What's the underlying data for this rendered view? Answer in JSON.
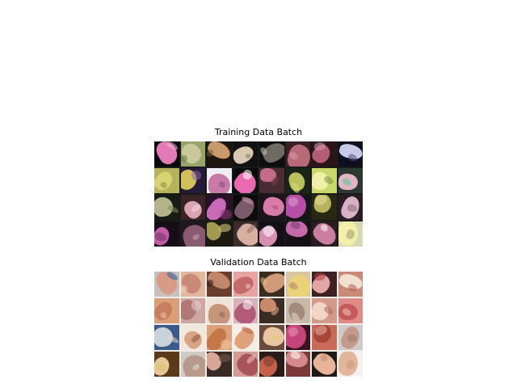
{
  "train": {
    "title": "Training Data Batch",
    "tiles": [
      {
        "bg": "#0a0a0a",
        "fg": "#e27bb5",
        "alt": "#f4b7d6"
      },
      {
        "bg": "#9aa36a",
        "fg": "#c9c89a",
        "alt": "#6f7a46"
      },
      {
        "bg": "#1b1410",
        "fg": "#c89a6a",
        "alt": "#7a5a3c"
      },
      {
        "bg": "#121212",
        "fg": "#d9c9b0",
        "alt": "#8b7a64"
      },
      {
        "bg": "#0d0d0d",
        "fg": "#6f6a62",
        "alt": "#c7c0b4"
      },
      {
        "bg": "#3a1f23",
        "fg": "#b86a79",
        "alt": "#dc9aa9"
      },
      {
        "bg": "#2a1518",
        "fg": "#b35d74",
        "alt": "#d79aae"
      },
      {
        "bg": "#0e1020",
        "fg": "#c7c9e6",
        "alt": "#4c4f7a"
      },
      {
        "bg": "#b6b15c",
        "fg": "#d7d474",
        "alt": "#8c8a3e"
      },
      {
        "bg": "#251a38",
        "fg": "#d1c05a",
        "alt": "#8a6aa8"
      },
      {
        "bg": "#f1edf4",
        "fg": "#c77aa8",
        "alt": "#8a4f7a"
      },
      {
        "bg": "#0b0b0b",
        "fg": "#e86ab0",
        "alt": "#ffffff"
      },
      {
        "bg": "#4a2c34",
        "fg": "#c26c88",
        "alt": "#7b3a51"
      },
      {
        "bg": "#1a2419",
        "fg": "#b9c05c",
        "alt": "#d7d879"
      },
      {
        "bg": "#c8d96a",
        "fg": "#efefaa",
        "alt": "#7d8e3b"
      },
      {
        "bg": "#2d3830",
        "fg": "#e1b5c3",
        "alt": "#56c79d"
      },
      {
        "bg": "#171d15",
        "fg": "#b4b48a",
        "alt": "#7f8a56"
      },
      {
        "bg": "#3a2226",
        "fg": "#d9a4b2",
        "alt": "#f1d7df"
      },
      {
        "bg": "#2b1029",
        "fg": "#c86bb6",
        "alt": "#8a3b7a"
      },
      {
        "bg": "#0b0b0b",
        "fg": "#7a5a6a",
        "alt": "#c39aac"
      },
      {
        "bg": "#1c1419",
        "fg": "#d97aa8",
        "alt": "#a24f7a"
      },
      {
        "bg": "#151515",
        "fg": "#b64fa6",
        "alt": "#dca3cd"
      },
      {
        "bg": "#2a2815",
        "fg": "#b7b25d",
        "alt": "#e6e39a"
      },
      {
        "bg": "#2a1e24",
        "fg": "#d7b2c3",
        "alt": "#8a6a80"
      },
      {
        "bg": "#160d18",
        "fg": "#c45ba6",
        "alt": "#6a3a66"
      },
      {
        "bg": "#21181d",
        "fg": "#8a5a73",
        "alt": "#cda1b7"
      },
      {
        "bg": "#1c190e",
        "fg": "#a39a52",
        "alt": "#e0d68a"
      },
      {
        "bg": "#3b2e2a",
        "fg": "#d7b0a2",
        "alt": "#9b6f62"
      },
      {
        "bg": "#151015",
        "fg": "#d48fb3",
        "alt": "#ffffff"
      },
      {
        "bg": "#161016",
        "fg": "#c46aa8",
        "alt": "#7a3a6a"
      },
      {
        "bg": "#2a1d22",
        "fg": "#c87fa0",
        "alt": "#ffffff"
      },
      {
        "bg": "#d8d8b0",
        "fg": "#f1efa8",
        "alt": "#9b9a6a"
      }
    ]
  },
  "val": {
    "title": "Validation Data Batch",
    "tiles": [
      {
        "bg": "#c7c0bd",
        "fg": "#d89b86",
        "alt": "#2c5c9a"
      },
      {
        "bg": "#e2b7a2",
        "fg": "#c88a74",
        "alt": "#f1d2c2"
      },
      {
        "bg": "#6a3e2c",
        "fg": "#c1876a",
        "alt": "#2a1a14"
      },
      {
        "bg": "#e7a2a2",
        "fg": "#c56a6a",
        "alt": "#f7d0c8"
      },
      {
        "bg": "#3a2c1e",
        "fg": "#d09a7a",
        "alt": "#e8c07a"
      },
      {
        "bg": "#d6c7a2",
        "fg": "#e9d27a",
        "alt": "#b87a6a"
      },
      {
        "bg": "#3e2222",
        "fg": "#e3a6a6",
        "alt": "#b23a3a"
      },
      {
        "bg": "#c98a78",
        "fg": "#f1e0d0",
        "alt": "#b55a5a"
      },
      {
        "bg": "#d89f7a",
        "fg": "#c97e60",
        "alt": "#e9c2a4"
      },
      {
        "bg": "#cda7a2",
        "fg": "#b07878",
        "alt": "#e9d0cb"
      },
      {
        "bg": "#efe2d6",
        "fg": "#c7967a",
        "alt": "#8a6a5a"
      },
      {
        "bg": "#d7b1bb",
        "fg": "#b25a7a",
        "alt": "#ffffff"
      },
      {
        "bg": "#3a2c24",
        "fg": "#c98a6a",
        "alt": "#e8b09a"
      },
      {
        "bg": "#c7b8a8",
        "fg": "#a38a7a",
        "alt": "#e7d8c7"
      },
      {
        "bg": "#d39a8a",
        "fg": "#f1d6c8",
        "alt": "#b06a5a"
      },
      {
        "bg": "#e18a8a",
        "fg": "#c45a5a",
        "alt": "#f4c2b8"
      },
      {
        "bg": "#3a5a8a",
        "fg": "#c9d2da",
        "alt": "#e9d7c7"
      },
      {
        "bg": "#f2e7dd",
        "fg": "#d9a484",
        "alt": "#8a5a3a"
      },
      {
        "bg": "#dca07a",
        "fg": "#c27848",
        "alt": "#f2c89a"
      },
      {
        "bg": "#f5ede6",
        "fg": "#e0a27a",
        "alt": "#b26a4a"
      },
      {
        "bg": "#6a4a3a",
        "fg": "#e9c5a2",
        "alt": "#e1d05a"
      },
      {
        "bg": "#3a1424",
        "fg": "#c4457a",
        "alt": "#e89ab6"
      },
      {
        "bg": "#c76a5a",
        "fg": "#a8463a",
        "alt": "#e9b29a"
      },
      {
        "bg": "#cfcac7",
        "fg": "#c49a8a",
        "alt": "#9b7a6a"
      },
      {
        "bg": "#5a3a1a",
        "fg": "#e9c79a",
        "alt": "#d8c46a"
      },
      {
        "bg": "#cfcac6",
        "fg": "#b79a8a",
        "alt": "#e8e2dc"
      },
      {
        "bg": "#3a2a24",
        "fg": "#d9a79a",
        "alt": "#7a5a4a"
      },
      {
        "bg": "#d39a96",
        "fg": "#a8545a",
        "alt": "#efc7c2"
      },
      {
        "bg": "#2a1a18",
        "fg": "#c6604a",
        "alt": "#7a3a2a"
      },
      {
        "bg": "#7a3a3a",
        "fg": "#d48a8a",
        "alt": "#ffffff"
      },
      {
        "bg": "#1e1a18",
        "fg": "#e7b49a",
        "alt": "#c08a6a"
      },
      {
        "bg": "#f6f1ec",
        "fg": "#e2b69a",
        "alt": "#c89a80"
      }
    ]
  }
}
